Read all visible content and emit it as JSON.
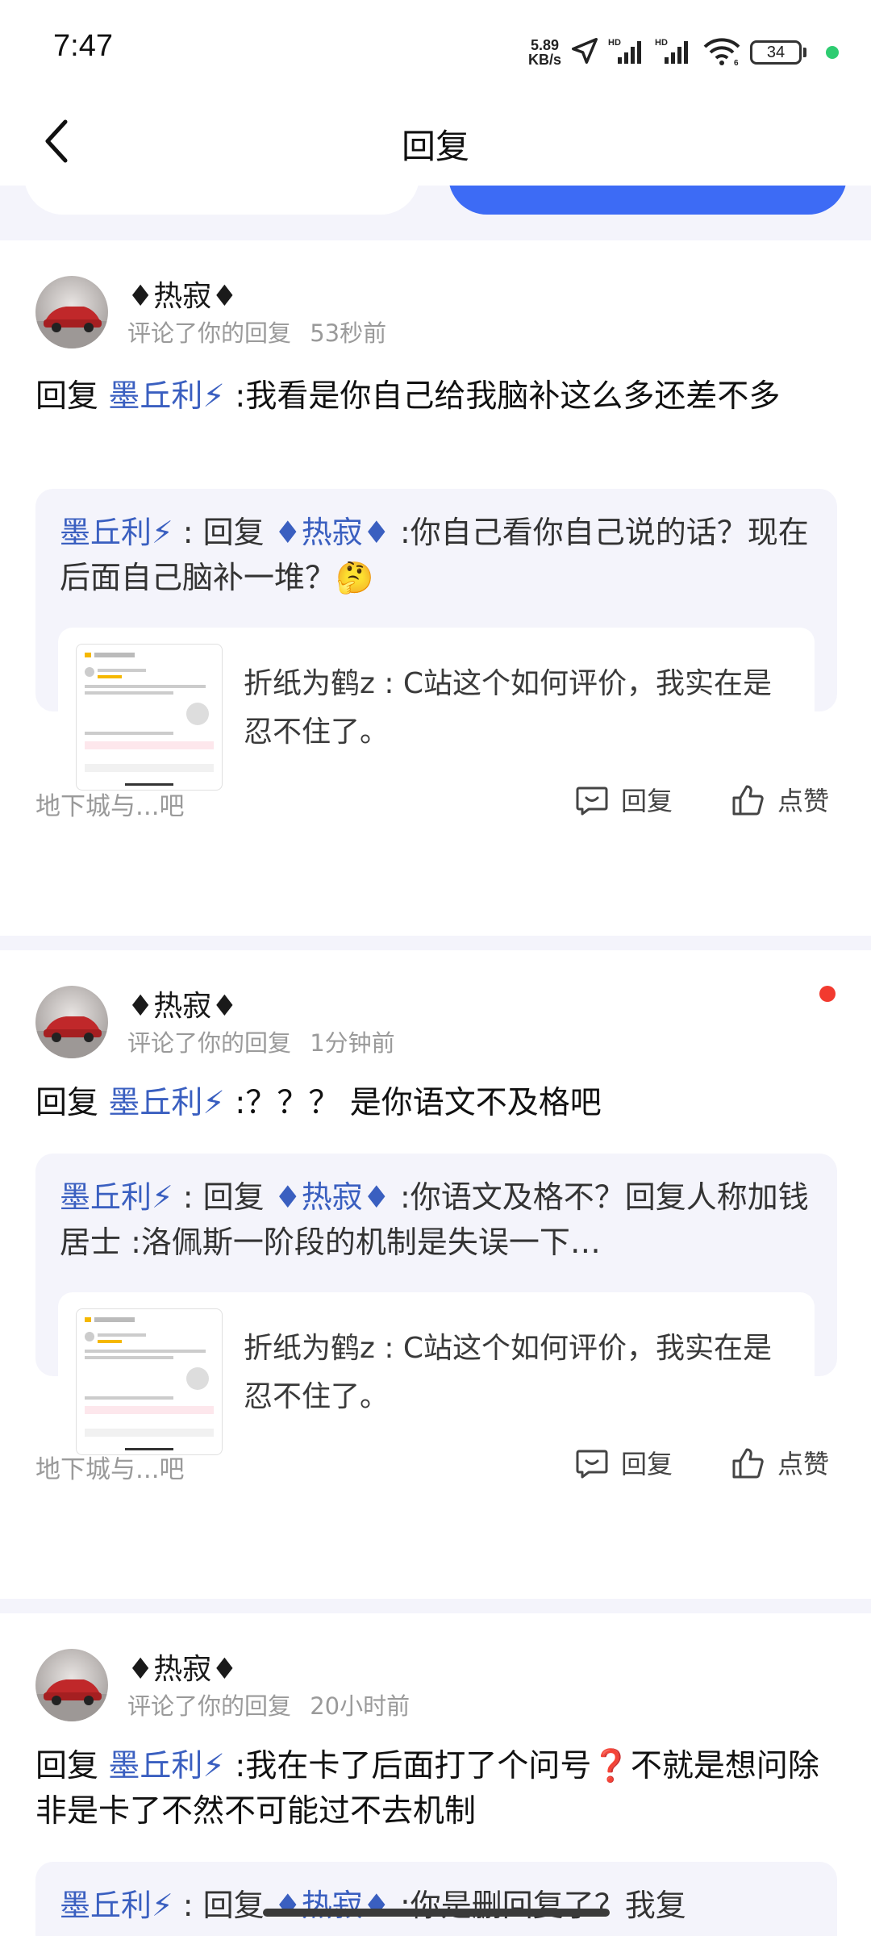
{
  "status": {
    "time": "7:47",
    "net_speed_value": "5.89",
    "net_speed_unit": "KB/s",
    "battery": "34"
  },
  "nav": {
    "title": "回复"
  },
  "cards": [
    {
      "username": "♦热寂♦",
      "action_text": "评论了你的回复",
      "time": "53秒前",
      "reply_prefix": "回复 ",
      "reply_mention": "墨丘利⚡",
      "reply_body": " :我看是你自己给我脑补这么多还差不多",
      "quote_author": "墨丘利⚡",
      "quote_mid": " : 回复 ",
      "quote_mention": "♦热寂♦",
      "quote_body": " :你自己看你自己说的话？现在后面自己脑补一堆？🤔",
      "post_text": "折纸为鹤z : C站这个如何评价，我实在是忍不住了。",
      "forum": "地下城与...吧",
      "reply_label": "回复",
      "like_label": "点赞",
      "unread": false
    },
    {
      "username": "♦热寂♦",
      "action_text": "评论了你的回复",
      "time": "1分钟前",
      "reply_prefix": "回复 ",
      "reply_mention": "墨丘利⚡",
      "reply_body": " :？？？ 是你语文不及格吧",
      "quote_author": "墨丘利⚡",
      "quote_mid": " : 回复 ",
      "quote_mention": "♦热寂♦",
      "quote_body": " :你语文及格不？回复人称加钱居士 :洛佩斯一阶段的机制是失误一下…",
      "post_text": "折纸为鹤z : C站这个如何评价，我实在是忍不住了。",
      "forum": "地下城与...吧",
      "reply_label": "回复",
      "like_label": "点赞",
      "unread": true
    },
    {
      "username": "♦热寂♦",
      "action_text": "评论了你的回复",
      "time": "20小时前",
      "reply_prefix": "回复 ",
      "reply_mention": "墨丘利⚡",
      "reply_body": " :我在卡了后面打了个问号❓不就是想问除非是卡了不然不可能过不去机制",
      "quote_author": "墨丘利⚡",
      "quote_mid": " : 回复 ",
      "quote_mention": "♦热寂♦",
      "quote_body": " :你是删回复了？我复"
    }
  ],
  "colors": {
    "accent_blue": "#3d6bf5",
    "mention_blue": "#3a5fc0",
    "unread_red": "#f23a2f",
    "quote_bg": "#f4f4fb"
  }
}
